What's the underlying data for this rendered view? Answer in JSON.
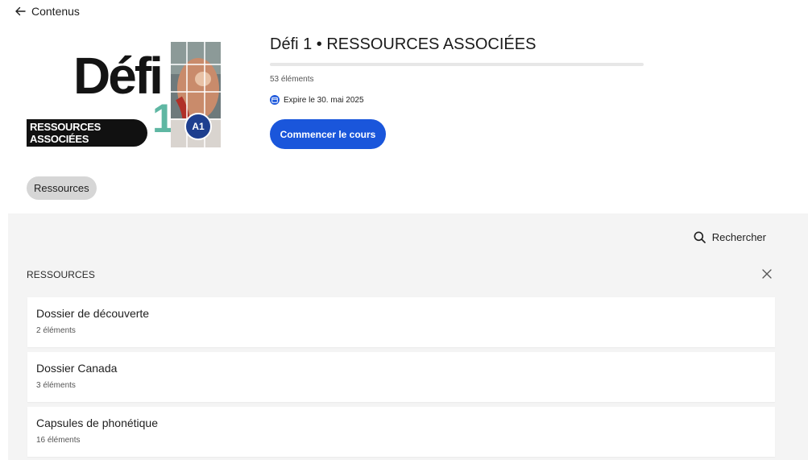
{
  "nav": {
    "back_label": "Contenus"
  },
  "cover": {
    "logo_word": "Défi",
    "logo_number": "1",
    "ribbon_text": "RESSOURCES ASSOCIÉES",
    "level_badge": "A1"
  },
  "course": {
    "title": "Défi 1 • RESSOURCES ASSOCIÉES",
    "progress_fraction": 0.0,
    "element_count": "53 éléments",
    "expiry": "Expire le 30. mai 2025",
    "start_label": "Commencer le cours"
  },
  "filter": {
    "chip_label": "Ressources"
  },
  "panel": {
    "search_label": "Rechercher",
    "section_title": "RESSOURCES",
    "items": [
      {
        "name": "Dossier de découverte",
        "count": "2 éléments"
      },
      {
        "name": "Dossier Canada",
        "count": "3 éléments"
      },
      {
        "name": "Capsules de phonétique",
        "count": "16 éléments"
      }
    ]
  },
  "colors": {
    "accent": "#1a56db",
    "panel_bg": "#f4f4f4",
    "chip_bg": "#d6d6d6",
    "logo_teal": "#5fb7a3",
    "badge_blue": "#1e3f8f"
  }
}
